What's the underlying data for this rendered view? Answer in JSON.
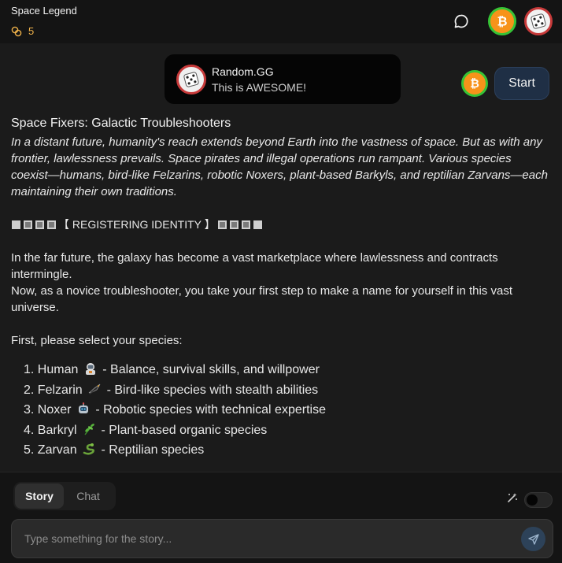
{
  "header": {
    "title": "Space Legend",
    "coin_count": "5",
    "icons": [
      "coins-icon",
      "chat-bubble-icon",
      "bitcoin-avatar",
      "dice-avatar"
    ]
  },
  "notification": {
    "name": "Random.GG",
    "message": "This is AWESOME!"
  },
  "start_button": {
    "label": "Start"
  },
  "story": {
    "title": "Space Fixers: Galactic Troubleshooters",
    "intro": "In a distant future, humanity's reach extends beyond Earth into the vastness of space. But as with any frontier, lawlessness prevails. Space pirates and illegal operations run rampant. Various species coexist—humans, bird-like Felzarins, robotic Noxers, plant-based Barkyls, and reptilian Zarvans—each maintaining their own traditions.",
    "registering": "【 REGISTERING IDENTITY 】",
    "para1": "In the far future, the galaxy has become a vast marketplace where lawlessness and contracts intermingle.",
    "para2": "Now, as a novice troubleshooter, you take your first step to make a name for yourself in this vast universe.",
    "prompt": "First, please select your species:",
    "species": [
      {
        "num": "1.",
        "name": "Human",
        "desc": "- Balance, survival skills, and willpower",
        "icon": "astronaut-emoji"
      },
      {
        "num": "2.",
        "name": "Felzarin",
        "desc": "- Bird-like species with stealth abilities",
        "icon": "bird-emoji"
      },
      {
        "num": "3.",
        "name": "Noxer",
        "desc": "- Robotic species with technical expertise",
        "icon": "robot-emoji"
      },
      {
        "num": "4.",
        "name": "Barkryl",
        "desc": "- Plant-based organic species",
        "icon": "herb-emoji"
      },
      {
        "num": "5.",
        "name": "Zarvan",
        "desc": "- Reptilian species",
        "icon": "snake-emoji"
      }
    ]
  },
  "tabs": {
    "story": "Story",
    "chat": "Chat",
    "active": "Story"
  },
  "input": {
    "placeholder": "Type something for the story..."
  },
  "colors": {
    "accent_coin": "#f0b24a",
    "start_bg": "#1f2f45",
    "send_bg": "#2d4259"
  }
}
